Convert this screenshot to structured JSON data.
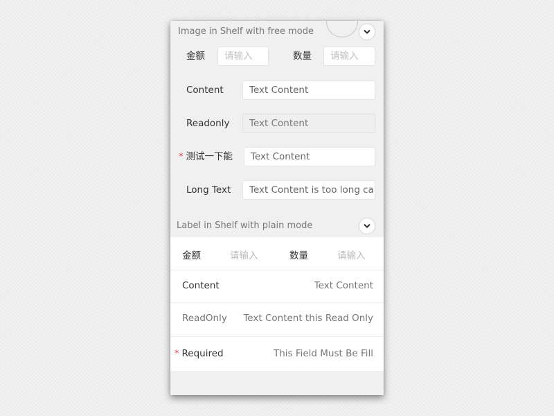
{
  "free_section": {
    "title": "Image in Shelf with free mode",
    "toggle_icon": "chevron-down-icon",
    "amount_label": "金额",
    "amount_placeholder": "请输入",
    "quantity_label": "数量",
    "quantity_placeholder": "请输入",
    "content_label": "Content",
    "content_value": "Text Content",
    "readonly_label": "Readonly",
    "readonly_value": "Text Content",
    "test_label": "测试一下能",
    "test_value": "Text Content",
    "long_label": "Long Text",
    "long_value": "Text Content is too long can not show all"
  },
  "plain_section": {
    "title": "Label in Shelf with plain mode",
    "toggle_icon": "chevron-down-icon",
    "amount_label": "金额",
    "amount_placeholder": "请输入",
    "quantity_label": "数量",
    "quantity_placeholder": "请输入",
    "content_label": "Content",
    "content_value": "Text Content",
    "readonly_label": "ReadOnly",
    "readonly_value": "Text Content this Read Only",
    "required_label": "Required",
    "required_value": "This Field Must Be Fill"
  },
  "required_mark": "*",
  "colors": {
    "required": "#e0424b",
    "background": "#f0f0f0",
    "field_bg": "#ffffff"
  }
}
